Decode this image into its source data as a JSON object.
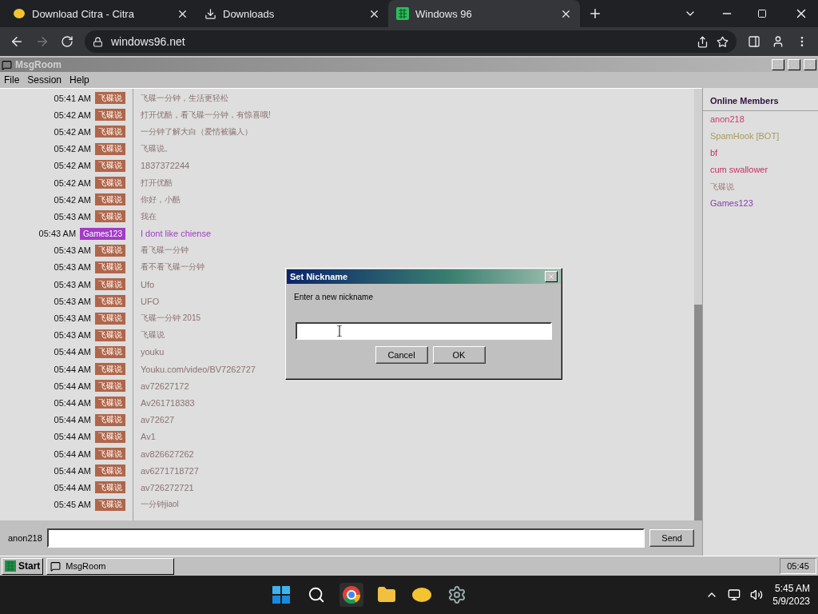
{
  "browser": {
    "tabs": [
      {
        "label": "Download Citra - Citra",
        "selected": false
      },
      {
        "label": "Downloads",
        "selected": false
      },
      {
        "label": "Windows 96",
        "selected": true
      }
    ],
    "url": "windows96.net"
  },
  "window": {
    "title": "MsgRoom",
    "menu": [
      "File",
      "Session",
      "Help"
    ]
  },
  "messages": [
    {
      "time": "05:41 AM",
      "user": "飞碟说",
      "color": "#b0664a",
      "text": "飞碟一分钟，生活更轻松"
    },
    {
      "time": "05:42 AM",
      "user": "飞碟说",
      "color": "#b0664a",
      "text": "打开优酷，看飞碟一分钟，有惊喜哦!"
    },
    {
      "time": "05:42 AM",
      "user": "飞碟说",
      "color": "#b0664a",
      "text": "一分钟了解大白（爱情被骗人）"
    },
    {
      "time": "05:42 AM",
      "user": "飞碟说",
      "color": "#b0664a",
      "text": "飞碟说。"
    },
    {
      "time": "05:42 AM",
      "user": "飞碟说",
      "color": "#b0664a",
      "text": "1837372244"
    },
    {
      "time": "05:42 AM",
      "user": "飞碟说",
      "color": "#b0664a",
      "text": "打开优酷"
    },
    {
      "time": "05:42 AM",
      "user": "飞碟说",
      "color": "#b0664a",
      "text": "你好，小酷"
    },
    {
      "time": "05:43 AM",
      "user": "飞碟说",
      "color": "#b0664a",
      "text": "我在"
    },
    {
      "time": "05:43 AM",
      "user": "Games123",
      "color": "#a23cc4",
      "text": "I dont like chiense"
    },
    {
      "time": "05:43 AM",
      "user": "飞碟说",
      "color": "#b0664a",
      "text": "看飞碟一分钟"
    },
    {
      "time": "05:43 AM",
      "user": "飞碟说",
      "color": "#b0664a",
      "text": "看不看飞碟一分钟"
    },
    {
      "time": "05:43 AM",
      "user": "飞碟说",
      "color": "#b0664a",
      "text": "Ufo"
    },
    {
      "time": "05:43 AM",
      "user": "飞碟说",
      "color": "#b0664a",
      "text": "UFO"
    },
    {
      "time": "05:43 AM",
      "user": "飞碟说",
      "color": "#b0664a",
      "text": "飞碟一分钟 2015"
    },
    {
      "time": "05:43 AM",
      "user": "飞碟说",
      "color": "#b0664a",
      "text": "飞碟说"
    },
    {
      "time": "05:44 AM",
      "user": "飞碟说",
      "color": "#b0664a",
      "text": "youku"
    },
    {
      "time": "05:44 AM",
      "user": "飞碟说",
      "color": "#b0664a",
      "text": "Youku.com/video/BV7262727"
    },
    {
      "time": "05:44 AM",
      "user": "飞碟说",
      "color": "#b0664a",
      "text": "av72627172"
    },
    {
      "time": "05:44 AM",
      "user": "飞碟说",
      "color": "#b0664a",
      "text": "Av261718383"
    },
    {
      "time": "05:44 AM",
      "user": "飞碟说",
      "color": "#b0664a",
      "text": "av72627"
    },
    {
      "time": "05:44 AM",
      "user": "飞碟说",
      "color": "#b0664a",
      "text": "Av1"
    },
    {
      "time": "05:44 AM",
      "user": "飞碟说",
      "color": "#b0664a",
      "text": "av826627262"
    },
    {
      "time": "05:44 AM",
      "user": "飞碟说",
      "color": "#b0664a",
      "text": "av6271718727"
    },
    {
      "time": "05:44 AM",
      "user": "飞碟说",
      "color": "#b0664a",
      "text": "av726272721"
    },
    {
      "time": "05:45 AM",
      "user": "飞碟说",
      "color": "#b0664a",
      "text": "一分钟jiaol"
    }
  ],
  "members": {
    "title": "Online Members",
    "items": [
      {
        "name": "anon218",
        "color": "#c8406a"
      },
      {
        "name": "SpamHook [BOT]",
        "color": "#a89a5c"
      },
      {
        "name": "bf",
        "color": "#c83060"
      },
      {
        "name": "cum swallower",
        "color": "#c83060"
      },
      {
        "name": "飞碟说",
        "color": "#a07878"
      },
      {
        "name": "Games123",
        "color": "#8a3cb0"
      }
    ]
  },
  "composer": {
    "nickname": "anon218",
    "send": "Send"
  },
  "dialog": {
    "title": "Set Nickname",
    "prompt": "Enter a new nickname",
    "cancel": "Cancel",
    "ok": "OK"
  },
  "taskbar96": {
    "start": "Start",
    "task": "MsgRoom",
    "clock": "05:45"
  },
  "systray": {
    "time": "5:45 AM",
    "date": "5/9/2023"
  }
}
